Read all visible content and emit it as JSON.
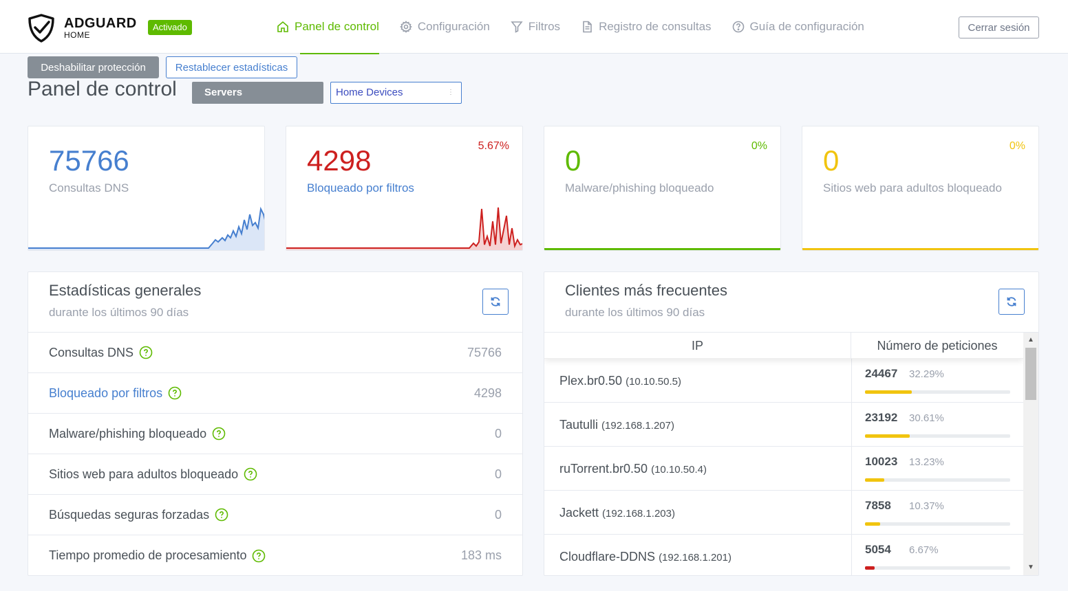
{
  "header": {
    "brand_name": "ADGUARD",
    "brand_sub": "HOME",
    "status_badge": "Activado",
    "nav": [
      {
        "label": "Panel de control",
        "icon": "home-icon"
      },
      {
        "label": "Configuración",
        "icon": "gear-icon"
      },
      {
        "label": "Filtros",
        "icon": "filter-icon"
      },
      {
        "label": "Registro de consultas",
        "icon": "document-icon"
      },
      {
        "label": "Guía de configuración",
        "icon": "help-circle-icon"
      }
    ],
    "logout_label": "Cerrar sesión"
  },
  "actions": {
    "disable_label": "Deshabilitar protección",
    "reset_label": "Restablecer estadísticas"
  },
  "page": {
    "title": "Panel de control",
    "select_servers": "Servers",
    "select_home": "Home Devices"
  },
  "stats": [
    {
      "value": "75766",
      "label": "Consultas DNS",
      "percent": "",
      "color": "#467fcf"
    },
    {
      "value": "4298",
      "label": "Bloqueado por filtros",
      "percent": "5.67%",
      "color": "#cd201f"
    },
    {
      "value": "0",
      "label": "Malware/phishing bloqueado",
      "percent": "0%",
      "color": "#5eba00"
    },
    {
      "value": "0",
      "label": "Sitios web para adultos bloqueado",
      "percent": "0%",
      "color": "#f1c40f"
    }
  ],
  "general": {
    "title": "Estadísticas generales",
    "subtitle": "durante los últimos 90 días",
    "rows": [
      {
        "label": "Consultas DNS",
        "value": "75766"
      },
      {
        "label": "Bloqueado por filtros",
        "value": "4298"
      },
      {
        "label": "Malware/phishing bloqueado",
        "value": "0"
      },
      {
        "label": "Sitios web para adultos bloqueado",
        "value": "0"
      },
      {
        "label": "Búsquedas seguras forzadas",
        "value": "0"
      },
      {
        "label": "Tiempo promedio de procesamiento",
        "value": "183 ms"
      }
    ]
  },
  "clients": {
    "title": "Clientes más frecuentes",
    "subtitle": "durante los últimos 90 días",
    "col_ip": "IP",
    "col_requests": "Número de peticiones",
    "rows": [
      {
        "name": "Plex.br0.50",
        "ip": "(10.10.50.5)",
        "count": "24467",
        "percent": "32.29%",
        "share": 0.3229,
        "color": "#f1c40f"
      },
      {
        "name": "Tautulli",
        "ip": "(192.168.1.207)",
        "count": "23192",
        "percent": "30.61%",
        "share": 0.3061,
        "color": "#f1c40f"
      },
      {
        "name": "ruTorrent.br0.50",
        "ip": "(10.10.50.4)",
        "count": "10023",
        "percent": "13.23%",
        "share": 0.1323,
        "color": "#f1c40f"
      },
      {
        "name": "Jackett",
        "ip": "(192.168.1.203)",
        "count": "7858",
        "percent": "10.37%",
        "share": 0.1037,
        "color": "#f1c40f"
      },
      {
        "name": "Cloudflare-DDNS",
        "ip": "(192.168.1.201)",
        "count": "5054",
        "percent": "6.67%",
        "share": 0.0667,
        "color": "#cd201f"
      }
    ]
  }
}
